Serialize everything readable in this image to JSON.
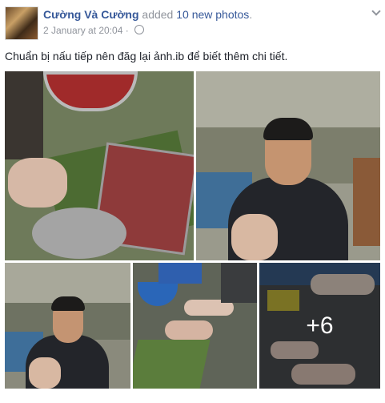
{
  "post": {
    "author": "Cường Và Cường",
    "action_prefix": "added",
    "action_count": "10 new photos",
    "action_suffix": ".",
    "timestamp": "2 January at 20:04",
    "separator": "·",
    "text": "Chuẩn bị nấu tiếp nên đăg lại ảnh.ib để biết thêm chi tiết."
  },
  "photos": {
    "more_count": "+6"
  },
  "colors": {
    "link": "#365899",
    "meta": "#90949c",
    "text": "#1d2129"
  }
}
